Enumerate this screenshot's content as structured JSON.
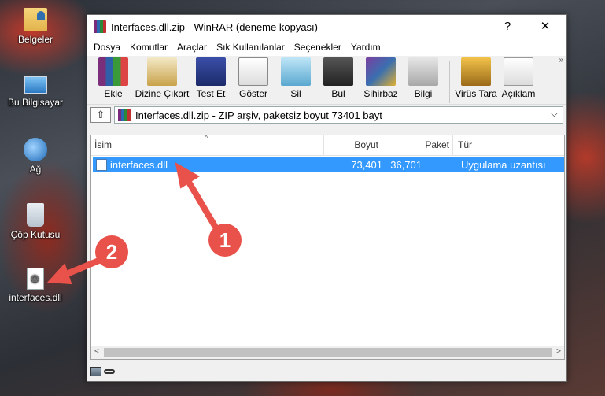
{
  "desktop": {
    "icons": [
      {
        "label": "Belgeler"
      },
      {
        "label": "Bu Bilgisayar"
      },
      {
        "label": "Ağ"
      },
      {
        "label": "Çöp Kutusu"
      },
      {
        "label": "interfaces.dll"
      }
    ]
  },
  "window": {
    "title": "Interfaces.dll.zip - WinRAR (deneme kopyası)",
    "help": "?",
    "close": "✕"
  },
  "menu": [
    "Dosya",
    "Komutlar",
    "Araçlar",
    "Sık Kullanılanlar",
    "Seçenekler",
    "Yardım"
  ],
  "toolbar": {
    "items": [
      "Ekle",
      "Dizine Çıkart",
      "Test Et",
      "Göster",
      "Sil",
      "Bul",
      "Sihirbaz",
      "Bilgi",
      "Virüs Tara",
      "Açıklam"
    ],
    "more": "»"
  },
  "pathbar": {
    "up": "⇧",
    "path": "Interfaces.dll.zip - ZIP arşiv, paketsiz boyut 73401 bayt",
    "chevron": "⌵"
  },
  "list": {
    "columns": {
      "name": "İsim",
      "size": "Boyut",
      "packed": "Paket",
      "type": "Tür"
    },
    "rows": [
      {
        "name": "interfaces.dll",
        "size": "73,401",
        "packed": "36,701",
        "type": "Uygulama uzantısı"
      }
    ],
    "sort_indicator": "^"
  },
  "scroll": {
    "left": "<",
    "right": ">"
  },
  "annotations": {
    "badge1": "1",
    "badge2": "2",
    "color": "#e8524a"
  }
}
